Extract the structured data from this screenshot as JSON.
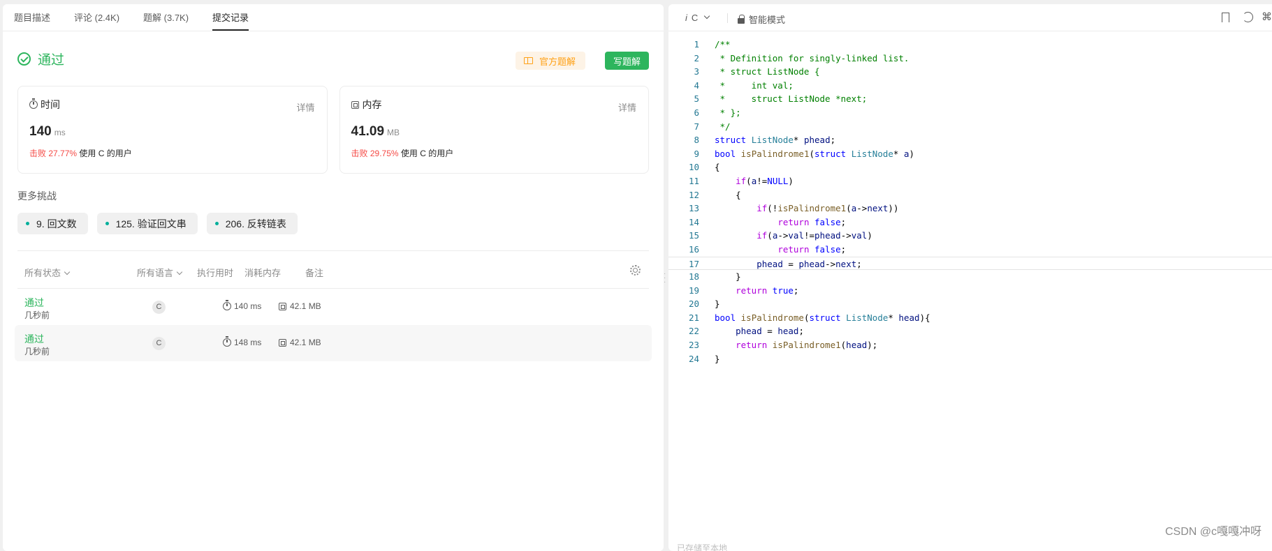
{
  "tabs": [
    "题目描述",
    "评论 (2.4K)",
    "题解 (3.7K)",
    "提交记录"
  ],
  "active_tab": 3,
  "result": {
    "status": "通过",
    "official_solution": "官方题解",
    "write_solution": "写题解"
  },
  "runtime": {
    "title": "时间",
    "detail": "详情",
    "value": "140",
    "unit": "ms",
    "beat_label": "击败",
    "beat_pct": "27.77%",
    "beat_suffix": "使用 C 的用户"
  },
  "memory": {
    "title": "内存",
    "detail": "详情",
    "value": "41.09",
    "unit": "MB",
    "beat_label": "击败",
    "beat_pct": "29.75%",
    "beat_suffix": "使用 C 的用户"
  },
  "more_challenges": {
    "title": "更多挑战",
    "items": [
      "9. 回文数",
      "125. 验证回文串",
      "206. 反转链表"
    ]
  },
  "list_header": {
    "status": "所有状态",
    "lang": "所有语言",
    "runtime": "执行用时",
    "memory": "消耗内存",
    "note": "备注"
  },
  "submissions": [
    {
      "status": "通过",
      "time": "几秒前",
      "lang": "C",
      "runtime": "140 ms",
      "memory": "42.1 MB"
    },
    {
      "status": "通过",
      "time": "几秒前",
      "lang": "C",
      "runtime": "148 ms",
      "memory": "42.1 MB"
    }
  ],
  "editor": {
    "lang_prefix": "i",
    "lang": "C",
    "mode": "智能模式",
    "footer": "已存储至本地",
    "current_line": 17
  },
  "code_lines": [
    "/**",
    " * Definition for singly-linked list.",
    " * struct ListNode {",
    " *     int val;",
    " *     struct ListNode *next;",
    " * };",
    " */",
    "struct ListNode* phead;",
    "bool isPalindrome1(struct ListNode* a)",
    "{",
    "    if(a!=NULL)",
    "    {",
    "        if(!isPalindrome1(a->next))",
    "            return false;",
    "        if(a->val!=phead->val)",
    "            return false;",
    "        phead = phead->next;",
    "    }",
    "    return true;",
    "}",
    "bool isPalindrome(struct ListNode* head){",
    "    phead = head;",
    "    return isPalindrome1(head);",
    "}"
  ],
  "watermark": "CSDN @c嘎嘎冲呀",
  "colors": {
    "accepted": "#2db55d",
    "beat": "#f54a45",
    "official": "#ffa116"
  }
}
